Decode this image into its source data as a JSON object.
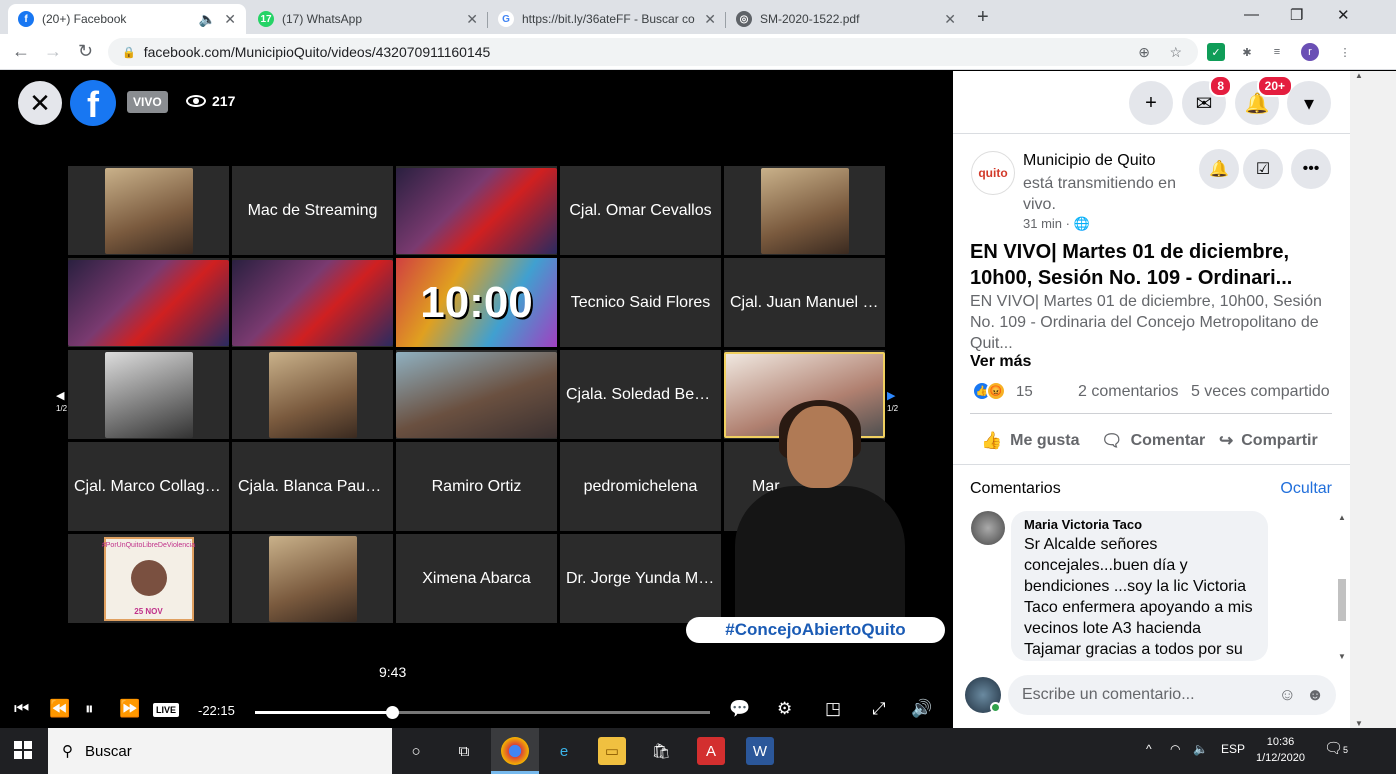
{
  "browser": {
    "tabs": [
      {
        "title": "(20+) Facebook",
        "fav_color": "#1877f2",
        "fav_glyph": "f"
      },
      {
        "title": "(17) WhatsApp",
        "fav_color": "#25d366",
        "fav_glyph": "17"
      },
      {
        "title": "https://bit.ly/36ateFF - Buscar co",
        "fav_color": "#4285f4",
        "fav_glyph": "G"
      },
      {
        "title": "SM-2020-1522.pdf",
        "fav_color": "#5f6368",
        "fav_glyph": "◎"
      }
    ],
    "url": "facebook.com/MunicipioQuito/videos/432070911160145",
    "profile_initial": "r"
  },
  "video": {
    "live_label": "VIVO",
    "viewers": "217",
    "participants": [
      {
        "name": "",
        "kind": "photo"
      },
      {
        "name": "Mac de Streaming",
        "kind": "text"
      },
      {
        "name": "",
        "kind": "flag"
      },
      {
        "name": "Cjal. Omar Cevallos",
        "kind": "text"
      },
      {
        "name": "",
        "kind": "photo"
      },
      {
        "name": "",
        "kind": "flag"
      },
      {
        "name": "",
        "kind": "flag"
      },
      {
        "name": "10:00",
        "kind": "timer"
      },
      {
        "name": "Tecnico Said Flores",
        "kind": "text"
      },
      {
        "name": "Cjal. Juan Manuel C...",
        "kind": "text"
      },
      {
        "name": "",
        "kind": "bw"
      },
      {
        "name": "",
        "kind": "photo"
      },
      {
        "name": "",
        "kind": "office"
      },
      {
        "name": "Cjala. Soledad Beníte...",
        "kind": "text"
      },
      {
        "name": "",
        "kind": "room"
      },
      {
        "name": "Cjal. Marco Collagu...",
        "kind": "text"
      },
      {
        "name": "Cjala. Blanca Paucar",
        "kind": "text"
      },
      {
        "name": "Ramiro Ortiz",
        "kind": "text"
      },
      {
        "name": "pedromichelena",
        "kind": "text"
      },
      {
        "name": "Mar",
        "kind": "text"
      },
      {
        "name": "",
        "kind": "poster"
      },
      {
        "name": "",
        "kind": "photo"
      },
      {
        "name": "Ximena Abarca",
        "kind": "text"
      },
      {
        "name": "Dr. Jorge Yunda Ma...",
        "kind": "text"
      },
      {
        "name": "",
        "kind": "empty"
      }
    ],
    "poster": {
      "text": "#PorUnQuitoLibreDeViolencia",
      "date": "25 NOV"
    },
    "page_indicator": "1/2",
    "hashtag": "#ConcejoAbiertoQuito",
    "hover_time": "9:43",
    "live_badge": "LIVE",
    "remaining": "-22:15",
    "progress": 0.3
  },
  "post": {
    "messenger_badge": "8",
    "notif_badge": "20+",
    "page_avatar_text": "quito",
    "page_name": "Municipio de Quito",
    "page_desc": "está transmitiendo en vivo.",
    "time": "31 min ·",
    "title": "EN VIVO| Martes 01 de diciembre, 10h00, Sesión No. 109 - Ordinari...",
    "body": "EN VIVO| Martes 01 de diciembre, 10h00, Sesión No. 109 - Ordinaria del Concejo Metropolitano de Quit...",
    "see_more": "Ver más",
    "reactions_count": "15",
    "comments_count": "2 comentarios",
    "shares_count": "5 veces compartido",
    "like_label": "Me gusta",
    "comment_label": "Comentar",
    "share_label": "Compartir",
    "comments_title": "Comentarios",
    "hide_label": "Ocultar",
    "comment": {
      "author": "Maria Victoria Taco",
      "text": "Sr Alcalde señores concejales...buen día y bendiciones ...soy la lic Victoria Taco enfermera apoyando a mis vecinos lote A3 hacienda Tajamar gracias a todos por su"
    },
    "input_placeholder": "Escribe un comentario..."
  },
  "taskbar": {
    "search_label": "Buscar",
    "lang": "ESP",
    "time": "10:36",
    "date": "1/12/2020",
    "notif_count": "5"
  }
}
